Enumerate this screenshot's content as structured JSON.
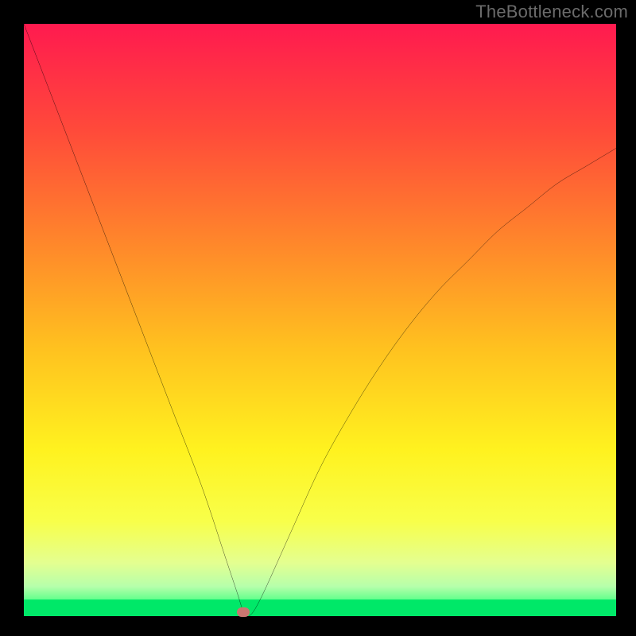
{
  "watermark": "TheBottleneck.com",
  "chart_data": {
    "type": "line",
    "title": "",
    "xlabel": "",
    "ylabel": "",
    "xlim": [
      0,
      100
    ],
    "ylim": [
      0,
      100
    ],
    "series": [
      {
        "name": "curve",
        "x": [
          0,
          5,
          10,
          15,
          20,
          25,
          30,
          34,
          36,
          37,
          38,
          40,
          45,
          50,
          55,
          60,
          65,
          70,
          75,
          80,
          85,
          90,
          95,
          100
        ],
        "values": [
          100,
          87,
          74,
          61,
          48,
          35,
          22,
          10,
          4,
          1,
          0,
          3,
          14,
          25,
          34,
          42,
          49,
          55,
          60,
          65,
          69,
          73,
          76,
          79
        ]
      }
    ],
    "marker": {
      "x": 37,
      "y": 0.7
    },
    "gradient_stops": [
      {
        "pct": 0,
        "color": "#ff1a4f"
      },
      {
        "pct": 18,
        "color": "#ff4a3a"
      },
      {
        "pct": 38,
        "color": "#ff8a2a"
      },
      {
        "pct": 55,
        "color": "#ffc21f"
      },
      {
        "pct": 72,
        "color": "#fff21f"
      },
      {
        "pct": 84,
        "color": "#f8ff4a"
      },
      {
        "pct": 91,
        "color": "#e4ff90"
      },
      {
        "pct": 95,
        "color": "#b6ffab"
      },
      {
        "pct": 97.5,
        "color": "#58ff88"
      },
      {
        "pct": 100,
        "color": "#00e868"
      }
    ],
    "green_band": {
      "from_pct": 97.2,
      "to_pct": 100,
      "color": "#00e868"
    }
  }
}
